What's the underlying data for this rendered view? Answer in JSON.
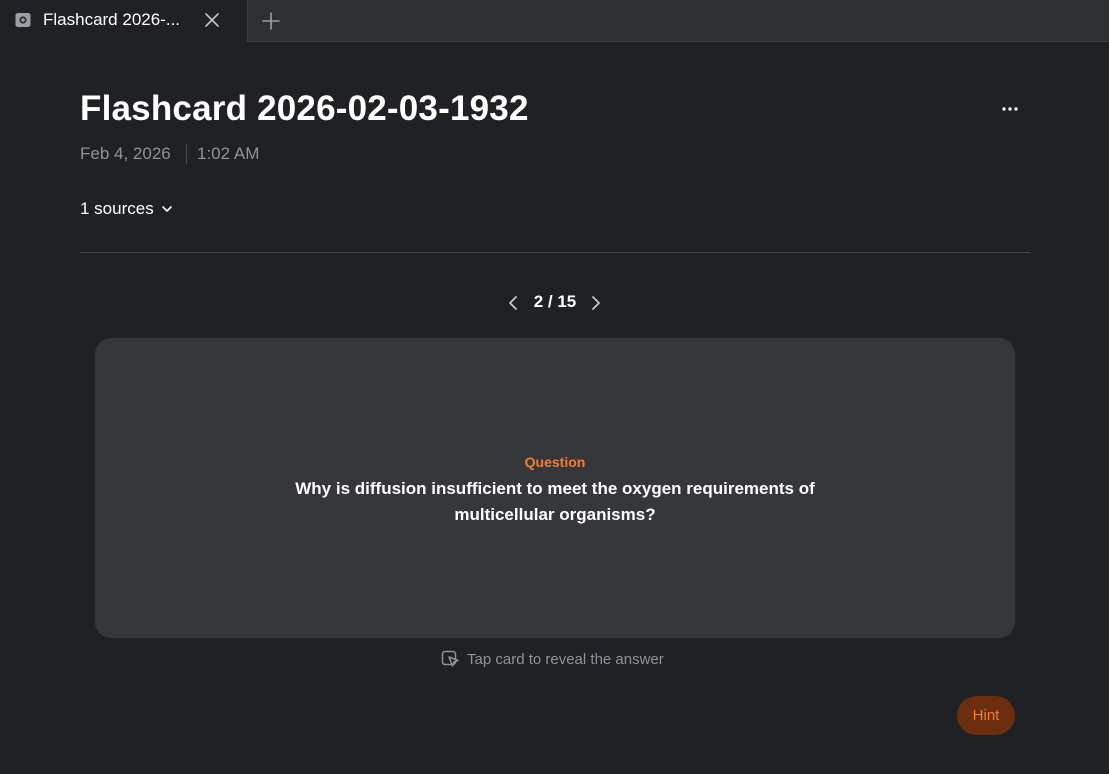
{
  "tab": {
    "title": "Flashcard 2026-...",
    "icon": "notebook-icon",
    "close_icon": "close-icon",
    "new_tab_icon": "plus-icon"
  },
  "header": {
    "title": "Flashcard 2026-02-03-1932",
    "date": "Feb 4, 2026",
    "time": "1:02 AM",
    "more_icon": "more-horizontal-icon"
  },
  "sources": {
    "label": "1 sources",
    "icon": "chevron-down-icon"
  },
  "pager": {
    "text": "2 / 15",
    "prev_icon": "chevron-left-icon",
    "next_icon": "chevron-right-icon"
  },
  "card": {
    "label": "Question",
    "question": "Why is diffusion insufficient to meet the oxygen requirements of multicellular organisms?",
    "reveal_hint": "Tap card to reveal the answer",
    "reveal_icon": "tap-card-icon"
  },
  "hint_button": {
    "label": "Hint"
  },
  "colors": {
    "background": "#202124",
    "card": "#35373b",
    "accent": "#f47b2f",
    "hint_bg": "#6b2e0e",
    "muted_text": "#8f9299"
  }
}
